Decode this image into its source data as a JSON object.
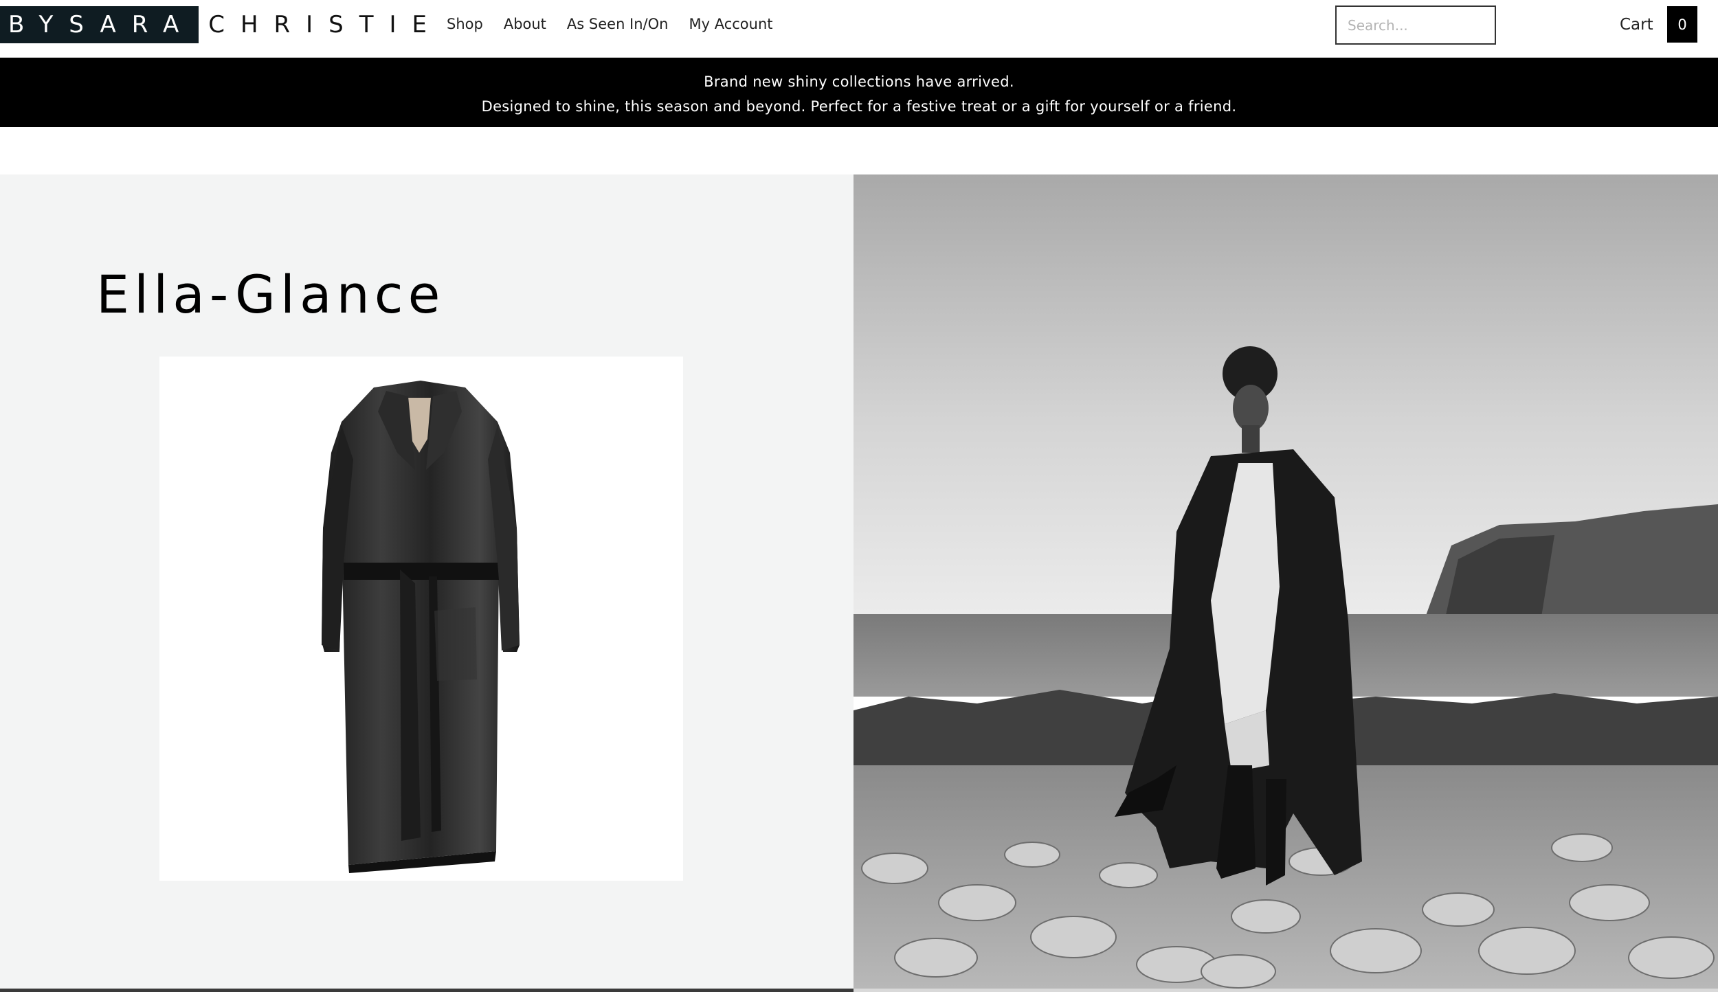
{
  "brand": {
    "logo_part1": "BYSARA",
    "logo_part2": "CHRISTIE"
  },
  "nav": {
    "items": [
      {
        "label": "Shop"
      },
      {
        "label": "About"
      },
      {
        "label": "As Seen In/On"
      },
      {
        "label": "My Account"
      }
    ]
  },
  "search": {
    "placeholder": "Search..."
  },
  "cart": {
    "label": "Cart",
    "count": "0"
  },
  "announcement": {
    "line1": "Brand new shiny collections have arrived.",
    "line2": "Designed to shine, this season and beyond. Perfect for a festive treat or a gift for yourself or a friend."
  },
  "hero": {
    "title": "Ella-Glance"
  },
  "colors": {
    "logo_bg": "#0f1c22",
    "announce_bg": "#000000",
    "hero_left_bg": "#f3f4f4"
  }
}
